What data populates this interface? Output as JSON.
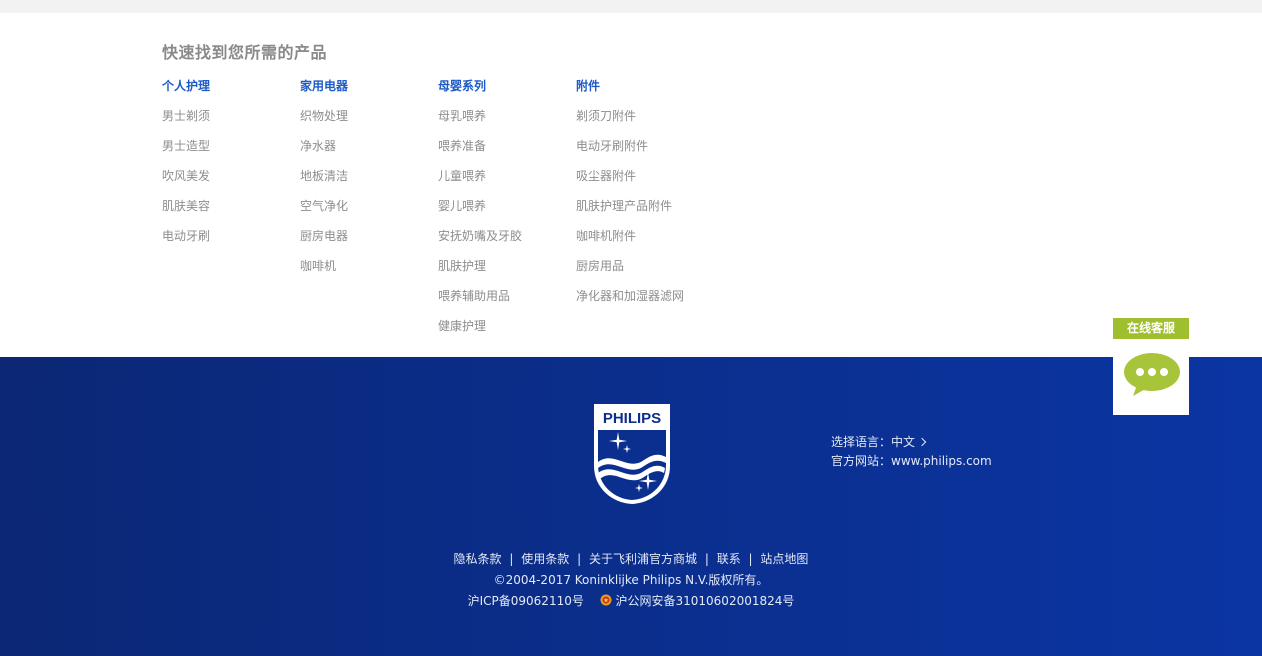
{
  "finder": {
    "title": "快速找到您所需的产品",
    "columns": [
      {
        "heading": "个人护理",
        "items": [
          "男士剃须",
          "男士造型",
          "吹风美发",
          "肌肤美容",
          "电动牙刷"
        ]
      },
      {
        "heading": "家用电器",
        "items": [
          "织物处理",
          "净水器",
          "地板清洁",
          "空气净化",
          "厨房电器",
          "咖啡机"
        ]
      },
      {
        "heading": "母婴系列",
        "items": [
          "母乳喂养",
          "喂养准备",
          "儿童喂养",
          "婴儿喂养",
          "安抚奶嘴及牙胶",
          "肌肤护理",
          "喂养辅助用品",
          "健康护理"
        ]
      },
      {
        "heading": "附件",
        "items": [
          "剃须刀附件",
          "电动牙刷附件",
          "吸尘器附件",
          "肌肤护理产品附件",
          "咖啡机附件",
          "厨房用品",
          "净化器和加湿器滤网"
        ]
      }
    ]
  },
  "footer": {
    "logo_text": "PHILIPS",
    "language_label": "选择语言：中文",
    "website_label": "官方网站：www.philips.com",
    "links": [
      "隐私条款",
      "使用条款",
      "关于飞利浦官方商城",
      "联系",
      "站点地图"
    ],
    "link_separator": "|",
    "copyright": "©2004-2017 Koninklijke Philips N.V.版权所有。",
    "icp": "沪ICP备09062110号",
    "police_record": "沪公网安备31010602001824号"
  },
  "chat": {
    "label": "在线客服"
  },
  "colors": {
    "accent_blue": "#1e5bc6",
    "footer_blue": "#0b2f8f",
    "chat_green": "#9fbf2f",
    "muted_text": "#8d8d8d"
  },
  "icons": [
    "philips-shield-logo",
    "chevron-right-icon",
    "police-badge-icon",
    "chat-bubble-icon"
  ]
}
